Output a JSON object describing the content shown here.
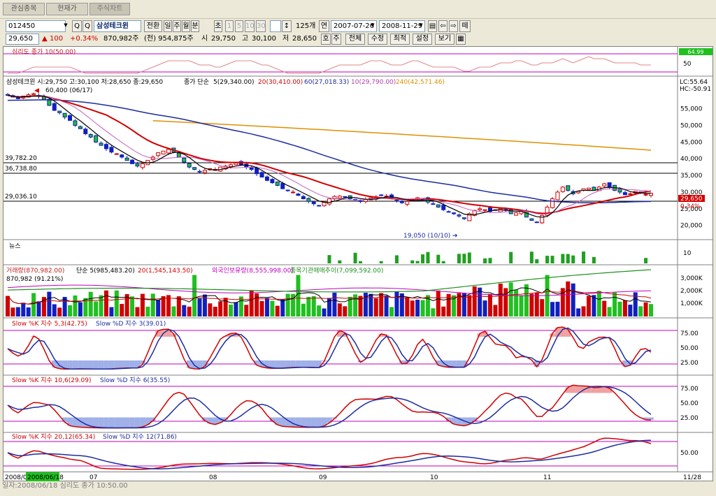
{
  "tabs": [
    "관심종목",
    "현재가",
    "주식차트"
  ],
  "toolbar": {
    "code": "012450",
    "company": "삼성테크윈",
    "switch_label": "전환",
    "periods": [
      "일",
      "주",
      "월",
      "분",
      "초"
    ],
    "minutes": [
      "1",
      "5",
      "10",
      "30"
    ],
    "count": "125개",
    "interval_label": "연",
    "start_date": "2007-07-26",
    "end_date": "2008-11-29",
    "view_label": "떼"
  },
  "quote": {
    "price": "29,650",
    "change": "100",
    "change_pct": "+0.34%",
    "volume": "870,982주",
    "prev_volume": "(전) 954,875주",
    "open_label": "시",
    "open": "29,750",
    "high_label": "고",
    "high": "30,100",
    "low_label": "저",
    "low": "28,650",
    "buttons": [
      "호",
      "주",
      "전체",
      "수정",
      "최적",
      "설정",
      "보기"
    ]
  },
  "psych": {
    "label": "심리도 종가 10(50.00)",
    "badge": "64.99",
    "ticks": [
      "50"
    ]
  },
  "price_pane": {
    "title": "삼성테크윈 시:29,750 고:30,100 저:28,650 종:29,650",
    "ma_header": "종가 단순",
    "ma": [
      {
        "label": "5(29,340.00)",
        "color": "#000000"
      },
      {
        "label": "20(30,410.00)",
        "color": "#d00000"
      },
      {
        "label": "60(27,018.33)",
        "color": "#1c2ca0"
      },
      {
        "label": "10(29,790.00)",
        "color": "#b040b0"
      },
      {
        "label": "240(42,571.46)",
        "color": "#e09000"
      }
    ],
    "high_note": "60,400 (06/17)",
    "low_note": "19,050 (10/10)",
    "levels": [
      "39,782.20",
      "36,738.80",
      "29,036.10"
    ],
    "lc": "LC:55.64",
    "hc": "HC:-50.91",
    "price_tag": "29,650",
    "pct_tag": "0.34%",
    "yticks": [
      "55,000",
      "50,000",
      "45,000",
      "40,000",
      "35,000",
      "30,000",
      "25,000",
      "20,000"
    ]
  },
  "news": {
    "label": "뉴스",
    "tick": "10"
  },
  "volume_pane": {
    "label": "거래량(870,982.00)",
    "ma_label": "단순 5(985,483.20)",
    "ma20_label": "20(1,545,143.50)",
    "foreign": "외국인보유량(8,555,998.00)",
    "inst": "종목기관매매추이(7,099,592.00)",
    "volume_note": "870,982 (91.21%)",
    "yticks": [
      "3,000K",
      "2,000K",
      "1,000K"
    ]
  },
  "stoch": [
    {
      "k": "Slow %K 지수 5,3(42.75)",
      "d": "Slow %D 지수 3(39.01)",
      "ticks": [
        "75.00",
        "50.00",
        "25.00"
      ]
    },
    {
      "k": "Slow %K 지수 10,6(29.09)",
      "d": "Slow %D 지수 6(35.55)",
      "ticks": [
        "75.00",
        "50.00",
        "25.00"
      ]
    },
    {
      "k": "Slow %K 지수 20,12(65.34)",
      "d": "Slow %D 지수 12(71.86)",
      "ticks": [
        "50.00"
      ]
    }
  ],
  "xaxis": {
    "start": "2008/0",
    "cursor": "2008/06/18",
    "months": [
      "07",
      "08",
      "09",
      "10",
      "11"
    ],
    "end": "11/28"
  },
  "status": "일자:2008/06/18 심리도 종가 10:50.00",
  "chart_data": {
    "type": "candlestick",
    "x_start": "2008-06-09",
    "x_end": "2008-11-28",
    "ylim": [
      17000,
      61000
    ],
    "close": [
      59000,
      58500,
      58000,
      58800,
      59200,
      59500,
      58700,
      57800,
      56000,
      54500,
      53800,
      52500,
      51500,
      50000,
      49000,
      47500,
      46500,
      45000,
      44000,
      43000,
      42000,
      41500,
      40500,
      39500,
      38500,
      37800,
      38500,
      39500,
      40500,
      41800,
      42300,
      42800,
      42000,
      40500,
      39000,
      37500,
      36800,
      36000,
      36500,
      37000,
      36800,
      37500,
      37800,
      38200,
      38700,
      38200,
      37500,
      36800,
      35500,
      34500,
      33500,
      32800,
      32000,
      31000,
      30500,
      30000,
      29000,
      28000,
      27200,
      26500,
      26000,
      27000,
      28000,
      28700,
      28800,
      28500,
      28000,
      27700,
      27300,
      27800,
      28300,
      28600,
      29000,
      28800,
      28000,
      27500,
      26800,
      27200,
      27700,
      28300,
      27800,
      27000,
      26500,
      25500,
      24700,
      24000,
      23500,
      22800,
      22000,
      23500,
      24500,
      25000,
      24700,
      24200,
      24600,
      25000,
      24500,
      23500,
      23800,
      24300,
      22500,
      21500,
      21000,
      23000,
      25500,
      28000,
      30000,
      31500,
      30500,
      29500,
      30200,
      31000,
      31200,
      30500,
      31500,
      32500,
      31500,
      30500,
      30000,
      29200,
      29500,
      30200,
      29800,
      29300,
      29650
    ],
    "ma5_last": 29340,
    "ma10_last": 29790,
    "ma20_last": 30410,
    "ma60_last": 27018.33,
    "ma240_last": 42571.46,
    "volume_last": 870982,
    "volume_ma5": 985483.2,
    "volume_ma20": 1545143.5,
    "stoch_5_3": {
      "k": 42.75,
      "d": 39.01
    },
    "stoch_10_6": {
      "k": 29.09,
      "d": 35.55
    },
    "stoch_20_12": {
      "k": 65.34,
      "d": 71.86
    },
    "psychology_10": 50.0
  }
}
